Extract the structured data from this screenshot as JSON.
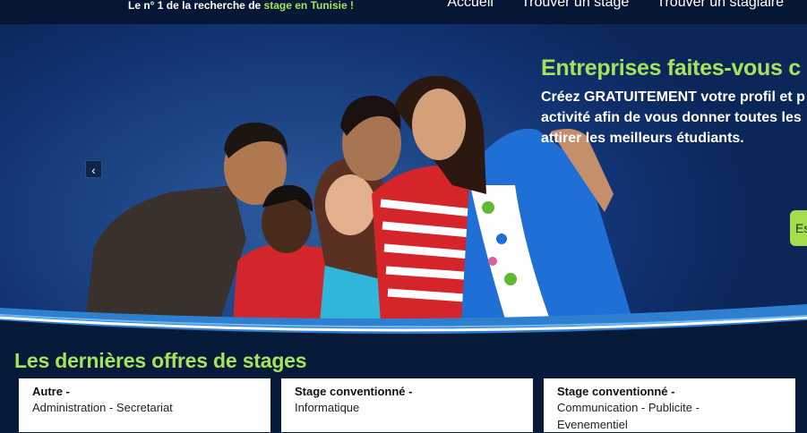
{
  "header": {
    "tagline_prefix": "Le n° 1 de la recherche de",
    "tagline_highlight": "stage en Tunisie !"
  },
  "nav": {
    "items": [
      {
        "label": "Accueil"
      },
      {
        "label": "Trouver un stage"
      },
      {
        "label": "Trouver un stagiaire"
      }
    ]
  },
  "hero": {
    "headline": "Entreprises faites-vous c",
    "text_line1": "Créez GRATUITEMENT votre profil et p",
    "text_line2": "activité afin de vous donner toutes les",
    "text_line3": "attirer les meilleurs étudiants.",
    "cta_label": "Es",
    "prev_glyph": "‹"
  },
  "offers": {
    "title": "Les dernières offres de stages",
    "cards": [
      {
        "type": "Autre -",
        "category": "Administration - Secretariat"
      },
      {
        "type": "Stage conventionné -",
        "category": "Informatique"
      },
      {
        "type": "Stage conventionné -",
        "category": "Communication - Publicite - Evenementiel"
      }
    ]
  },
  "colors": {
    "accent": "#a6e35a",
    "background": "#071a3a",
    "hero_blue": "#1d4585"
  }
}
